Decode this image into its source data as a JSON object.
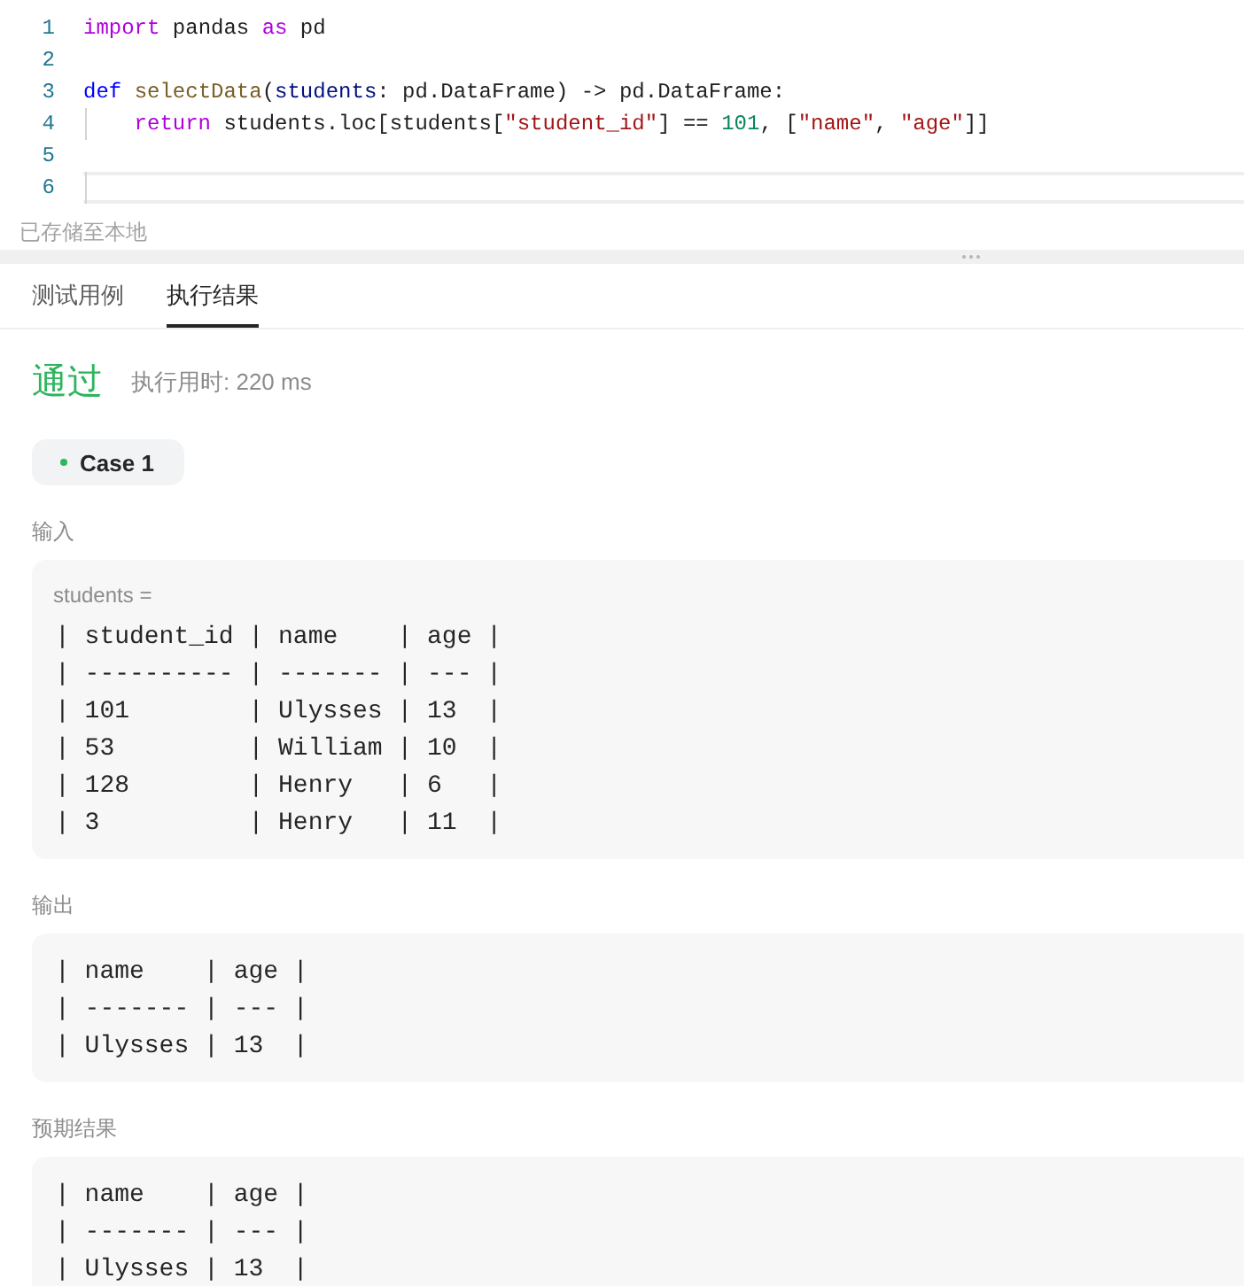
{
  "editor": {
    "lines": [
      {
        "number": "1",
        "tokens": [
          {
            "text": "import",
            "kind": "keyword"
          },
          {
            "text": " pandas ",
            "kind": "plain"
          },
          {
            "text": "as",
            "kind": "keyword"
          },
          {
            "text": " pd",
            "kind": "plain"
          }
        ],
        "current": false,
        "indent_guide": false
      },
      {
        "number": "2",
        "current": false,
        "indent_guide": false
      },
      {
        "number": "3",
        "tokens": [
          {
            "text": "def ",
            "kind": "storage"
          },
          {
            "text": "selectData",
            "kind": "function"
          },
          {
            "text": "(",
            "kind": "plain"
          },
          {
            "text": "students",
            "kind": "parameter"
          },
          {
            "text": ": pd.DataFrame) -> pd.DataFrame:",
            "kind": "plain"
          }
        ],
        "current": false,
        "indent_guide": false
      },
      {
        "number": "4",
        "tokens": [
          {
            "text": "    return",
            "kind": "keyword"
          },
          {
            "text": " students.loc[students[",
            "kind": "plain"
          },
          {
            "text": "\"student_id\"",
            "kind": "string"
          },
          {
            "text": "] == ",
            "kind": "plain"
          },
          {
            "text": "101",
            "kind": "number"
          },
          {
            "text": ", [",
            "kind": "plain"
          },
          {
            "text": "\"name\"",
            "kind": "string"
          },
          {
            "text": ", ",
            "kind": "plain"
          },
          {
            "text": "\"age\"",
            "kind": "string"
          },
          {
            "text": "]]",
            "kind": "plain"
          }
        ],
        "current": false,
        "indent_guide": true
      },
      {
        "number": "5",
        "current": false,
        "indent_guide": false
      },
      {
        "number": "6",
        "current": true,
        "indent_guide": true
      }
    ]
  },
  "save_status": "已存储至本地",
  "tabs": [
    {
      "label": "测试用例",
      "selected": false
    },
    {
      "label": "执行结果",
      "selected": true
    }
  ],
  "result": {
    "status": {
      "text": "通过",
      "kind": "accepted"
    },
    "runtime": "执行用时: 220 ms"
  },
  "cases": [
    {
      "label": "Case 1",
      "selected": true,
      "color": "#2db55d"
    }
  ],
  "sections": [
    {
      "label": "输入",
      "panel": {
        "variable": "students =",
        "lines": [
          "| student_id | name    | age |",
          "| ---------- | ------- | --- |",
          "| 101        | Ulysses | 13  |",
          "| 53         | William | 10  |",
          "| 128        | Henry   | 6   |",
          "| 3          | Henry   | 11  |"
        ]
      }
    },
    {
      "label": "输出",
      "panel": {
        "lines": [
          "| name    | age |",
          "| ------- | --- |",
          "| Ulysses | 13  |"
        ]
      }
    },
    {
      "label": "预期结果",
      "panel": {
        "lines": [
          "| name    | age |",
          "| ------- | --- |",
          "| Ulysses | 13  |"
        ]
      }
    }
  ]
}
